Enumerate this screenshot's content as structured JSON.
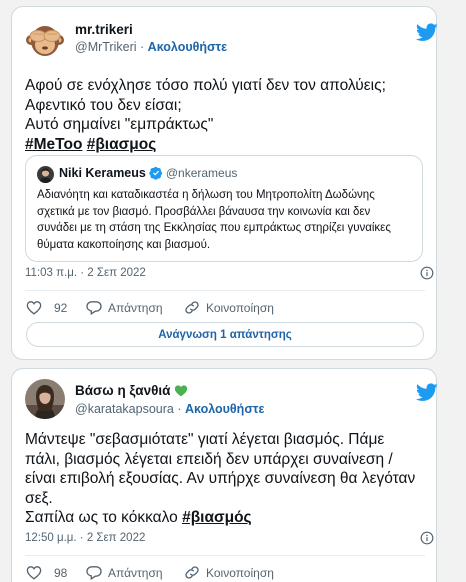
{
  "colors": {
    "link": "#1d64a8",
    "twitter_blue": "#1d9bf0",
    "verified": "#1d9bf0",
    "heart_green": "#4caf50"
  },
  "tweet1": {
    "author": {
      "name": "mr.trikeri",
      "handle": "@MrTrikeri",
      "separator": "·",
      "follow_label": "Ακολουθήστε",
      "avatar_icon": "monkey-see-no-evil-emoji"
    },
    "lines": [
      "Αφού σε ενόχλησε τόσο πολύ γιατί δεν τον απολύεις;",
      "Αφεντικό του δεν είσαι;",
      "Αυτό σημαίνει \"εμπράκτως\""
    ],
    "hashtags": [
      "#MeToo",
      "#βιασμος"
    ],
    "quote": {
      "name": "Niki Kerameus",
      "handle": "@nkerameus",
      "separator": "·",
      "lines": [
        "Αδιανόητη και καταδικαστέα η δήλωση του Μητροπολίτη Δωδώνης",
        "σχετικά με τον βιασμό. Προσβάλλει βάναυσα την κοινωνία και δεν",
        "συνάδει με τη στάση της Εκκλησίας που εμπράκτως στηρίζει γυναίκες",
        "θύματα κακοποίησης και βιασμού."
      ]
    },
    "timestamp": "11:03 π.μ. · 2 Σεπ 2022",
    "likes": "92",
    "reply_label": "Απάντηση",
    "share_label": "Κοινοποίηση",
    "read_replies_label": "Ανάγνωση 1 απάντησης"
  },
  "tweet2": {
    "author": {
      "name": "Βάσω η ξανθιά",
      "name_emoji": "💚",
      "handle": "@karatakapsoura",
      "separator": "·",
      "follow_label": "Ακολουθήστε"
    },
    "lines": [
      "Μάντεψε \"σεβασμιότατε\" γιατί λέγεται βιασμός. Πάμε",
      "πάλι, βιασμός λέγεται επειδή δεν υπάρχει συναίνεση /",
      "είναι επιβολή εξουσίας. Αν υπήρχε συναίνεση θα λεγόταν",
      "σεξ."
    ],
    "last_line_prefix": "Σαπίλα ως το κόκκαλο ",
    "hashtag": "#βιασμός",
    "timestamp": "12:50 μ.μ. · 2 Σεπ 2022",
    "likes": "98",
    "reply_label": "Απάντηση",
    "share_label": "Κοινοποίηση"
  }
}
